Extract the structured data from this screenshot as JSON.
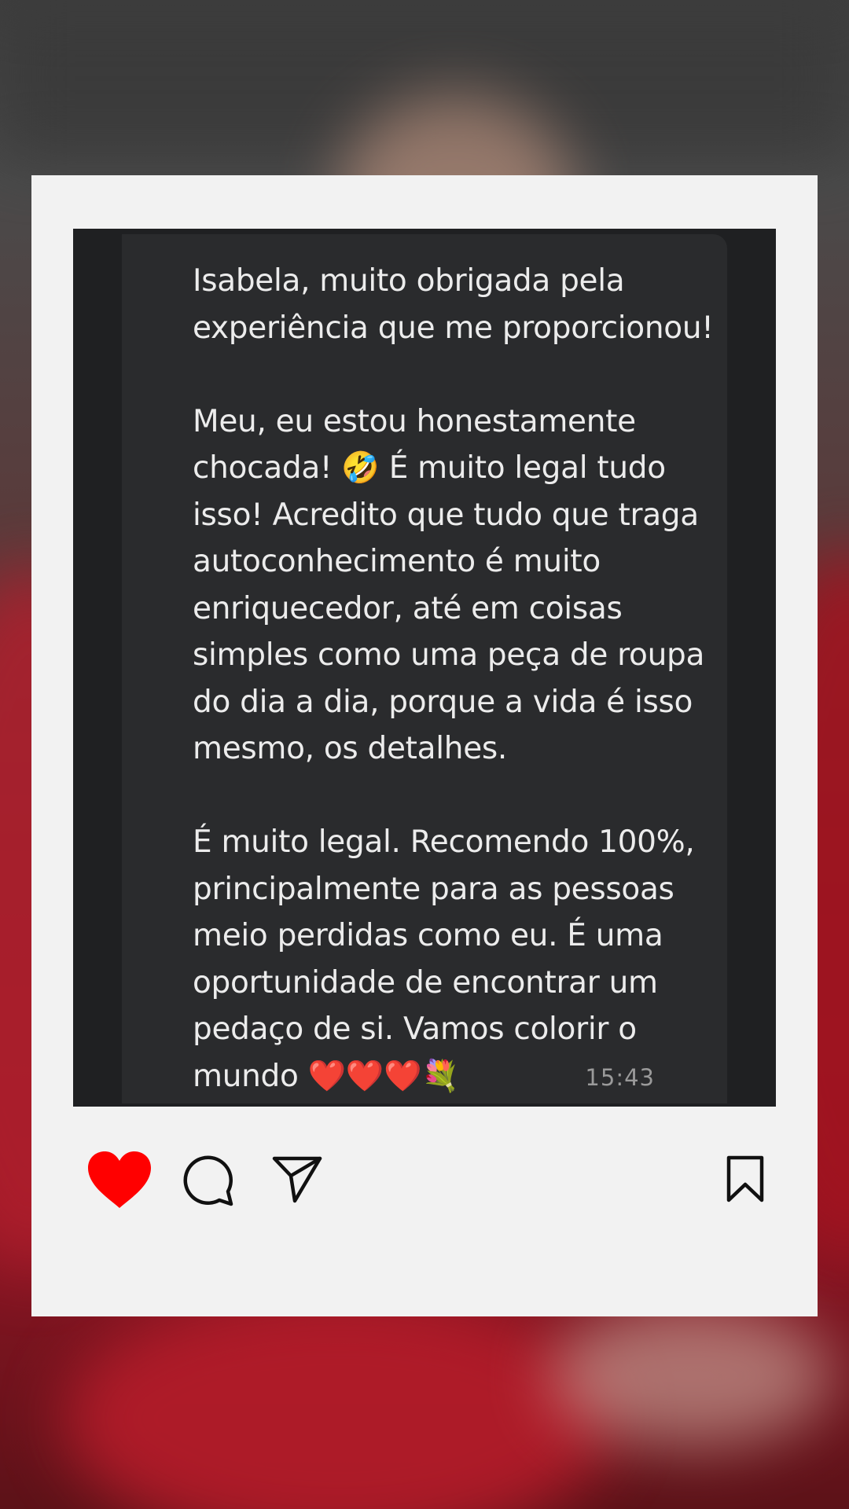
{
  "post": {
    "message": "Isabela, muito obrigada pela\nexperiência que me proporcionou!\n\nMeu, eu estou honestamente\nchocada! 🤣 É muito legal tudo\nisso! Acredito que tudo que traga\nautoconhecimento é muito\nenriquecedor, até em coisas\nsimples como uma peça de roupa\ndo dia a dia, porque a vida é isso\nmesmo, os detalhes.\n\nÉ muito legal. Recomendo 100%,\nprincipalmente para as pessoas\nmeio perdidas como eu. É uma\noportunidade de encontrar um\npedaço de si. Vamos colorir o\nmundo ❤️❤️❤️💐",
    "timestamp": "15:43"
  },
  "actions": {
    "like": {
      "icon": "heart-icon",
      "active": true,
      "color": "#ff0000"
    },
    "comment": {
      "icon": "comment-icon"
    },
    "share": {
      "icon": "paper-plane-icon"
    },
    "save": {
      "icon": "bookmark-icon"
    }
  },
  "colors": {
    "card": "#f2f2f2",
    "chat_background": "#1f2022",
    "bubble": "#2a2b2d",
    "message_text": "#ececec",
    "timestamp_text": "#9a9a9a"
  }
}
